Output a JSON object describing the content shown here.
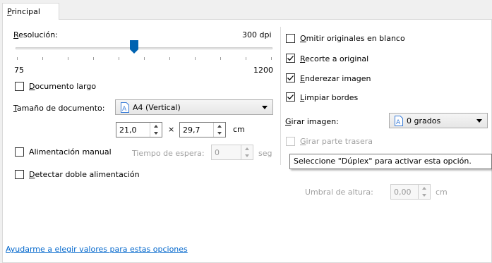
{
  "tab": {
    "label": "Principal"
  },
  "resolution": {
    "label": "Resolución:",
    "value_text": "300 dpi",
    "min_label": "75",
    "max_label": "1200",
    "value": 300,
    "min": 75,
    "max": 1200
  },
  "long_document": {
    "label": "Documento largo",
    "checked": false
  },
  "doc_size": {
    "label": "Tamaño de documento:",
    "selected": "A4 (Vertical)",
    "icon": "document-icon"
  },
  "dimensions": {
    "width": "21,0",
    "separator": "×",
    "height": "29,7",
    "unit": "cm"
  },
  "manual_feed": {
    "label": "Alimentación manual",
    "checked": false,
    "timeout_label": "Tiempo de espera:",
    "timeout_value": "0",
    "timeout_unit": "seg"
  },
  "double_feed": {
    "label": "Detectar doble alimentación",
    "checked": false
  },
  "right": {
    "omit_blank": {
      "label": "Omitir originales en blanco",
      "checked": false
    },
    "crop": {
      "label": "Recorte a original",
      "checked": true
    },
    "straighten": {
      "label": "Enderezar imagen",
      "checked": true
    },
    "clean_edges": {
      "label": "Limpiar bordes",
      "checked": true
    },
    "rotate": {
      "label": "Girar imagen:",
      "selected": "0 grados",
      "icon": "document-icon"
    },
    "rotate_back": {
      "label": "Girar parte trasera",
      "checked": false,
      "disabled": true
    },
    "height_threshold": {
      "label": "Umbral de altura:",
      "value": "0,00",
      "unit": "cm"
    }
  },
  "tooltip": {
    "text": "Seleccione \"Dúplex\" para activar esta opción."
  },
  "help_link": {
    "label": "Ayudarme a elegir valores para estas opciones"
  },
  "colors": {
    "accent": "#0066cc",
    "thumb": "#0063b1",
    "link": "#0066cc"
  }
}
